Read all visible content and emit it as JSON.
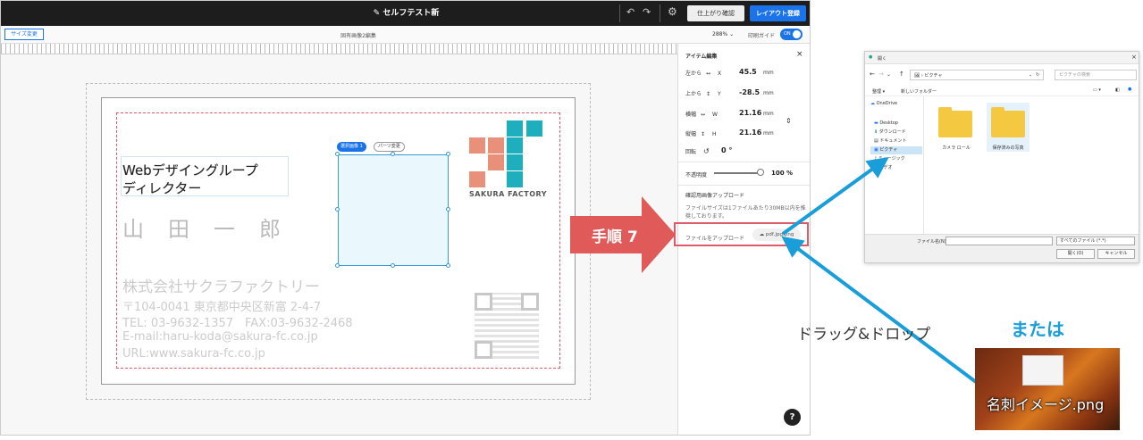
{
  "topbar": {
    "title": "セルフテスト新",
    "finish_button": "仕上がり確認",
    "register_button": "レイアウト登録"
  },
  "subbar": {
    "size_change": "サイズ変更",
    "doc_title": "固有画像2編集",
    "zoom": "288%",
    "print_guide": "印刷ガイド",
    "toggle_state": "ON"
  },
  "card": {
    "job_line1": "Webデザイングループ",
    "job_line2": "ディレクター",
    "name": "山田一郎",
    "company": "株式会社サクラファクトリー",
    "address": "〒104-0041 東京都中央区新富 2-4-7",
    "tel": "TEL: 03-9632-1357　FAX:03-9632-2468",
    "email": "E-mail:haru-koda@sakura-fc.co.jp",
    "url": "URL:www.sakura-fc.co.jp",
    "logo_text": "SAKURA FACTORY",
    "selected_tag": "選択画像 1",
    "parts_tag": "パーツ変更"
  },
  "panel": {
    "heading": "アイテム編集",
    "rows": [
      {
        "label": "左から",
        "axis": "X",
        "value": "45.5",
        "unit": "mm"
      },
      {
        "label": "上から",
        "axis": "Y",
        "value": "-28.5",
        "unit": "mm"
      },
      {
        "label": "横幅",
        "axis": "W",
        "value": "21.16",
        "unit": "mm"
      },
      {
        "label": "縦幅",
        "axis": "H",
        "value": "21.16",
        "unit": "mm"
      }
    ],
    "rotate_label": "回転",
    "rotate_value": "0 °",
    "opacity_label": "不透明度",
    "opacity_value": "100 %",
    "upload_heading": "確認用画像アップロード",
    "upload_desc": "ファイルサイズは1ファイルあたり30MB以内を推奨しております。",
    "upload_label": "ファイルをアップロード",
    "upload_button": "pdf,jpg,png",
    "help": "?"
  },
  "step": {
    "label": "手順 7",
    "color": "#e05a5a"
  },
  "explorer": {
    "title": "開く",
    "path": "ピクチャ",
    "search_placeholder": "ピクチャの検索",
    "organize": "整理 ▾",
    "new_folder": "新しいフォルダー",
    "sidebar": [
      "OneDrive",
      "Desktop",
      "ダウンロード",
      "ドキュメント",
      "ピクチャ",
      "ミュージック",
      "ビデオ"
    ],
    "folders": [
      "カメラ ロール",
      "保存済みの写真"
    ],
    "filename_label": "ファイル名(N):",
    "filter": "すべてのファイル (*.*)",
    "open_button": "開く(O)",
    "cancel_button": "キャンセル"
  },
  "annotations": {
    "drag_drop": "ドラッグ&ドロップ",
    "or": "または",
    "file_name": "名刺イメージ.png",
    "arrow_color": "#1a9ed9"
  }
}
